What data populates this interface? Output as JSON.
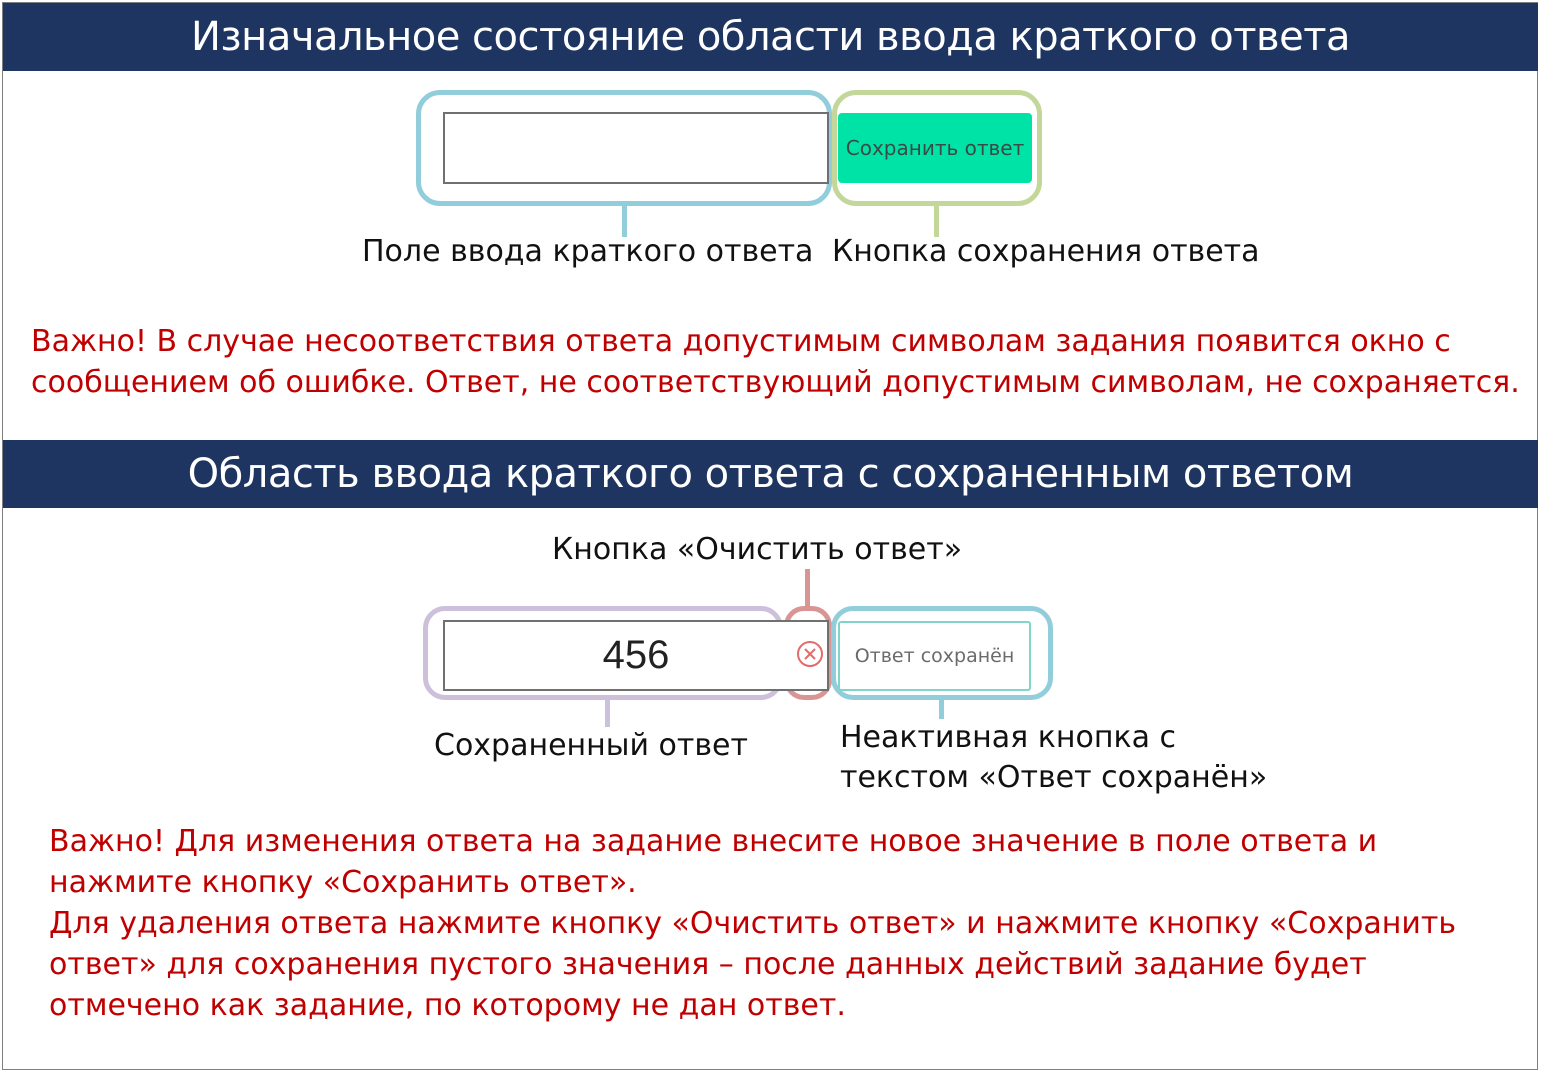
{
  "colors": {
    "banner_bg": "#1f3561",
    "banner_text": "#ffffff",
    "note_text": "#c00000",
    "save_button_bg": "#00e3a7",
    "save_button_text": "#3a4b45",
    "ring_input": "#92cddc",
    "ring_save": "#c4d79b",
    "ring_saved_value": "#ccc0da",
    "ring_clear": "#d99594",
    "ring_saved_button": "#92cddc",
    "saved_button_border": "#7fd6c8",
    "clear_icon": "#e06c6c"
  },
  "section1": {
    "title": "Изначальное состояние области ввода краткого ответа",
    "input": {
      "value": "",
      "placeholder": ""
    },
    "save_button_label": "Сохранить ответ",
    "label_input": "Поле ввода краткого ответа",
    "label_save": "Кнопка сохранения ответа",
    "note_lines": [
      "Важно! В случае несоответствия ответа допустимым символам задания появится окно с",
      "сообщением об ошибке. Ответ, не соответствующий допустимым символам, не сохраняется."
    ]
  },
  "section2": {
    "title": "Область ввода краткого ответа с сохраненным ответом",
    "label_clear": "Кнопка «Очистить ответ»",
    "input": {
      "value": "456"
    },
    "clear_icon": "circle-x-icon",
    "saved_button_label": "Ответ сохранён",
    "label_saved_value": "Сохраненный ответ",
    "label_saved_button_lines": [
      "Неактивная кнопка с",
      "текстом «Ответ сохранён»"
    ],
    "note_lines": [
      "Важно! Для изменения ответа на задание внесите новое значение в поле ответа и",
      "нажмите кнопку «Сохранить ответ».",
      "Для удаления ответа нажмите кнопку «Очистить ответ» и нажмите кнопку «Сохранить",
      "ответ» для сохранения пустого значения – после данных действий задание будет",
      "отмечено как задание, по которому не дан ответ."
    ]
  }
}
